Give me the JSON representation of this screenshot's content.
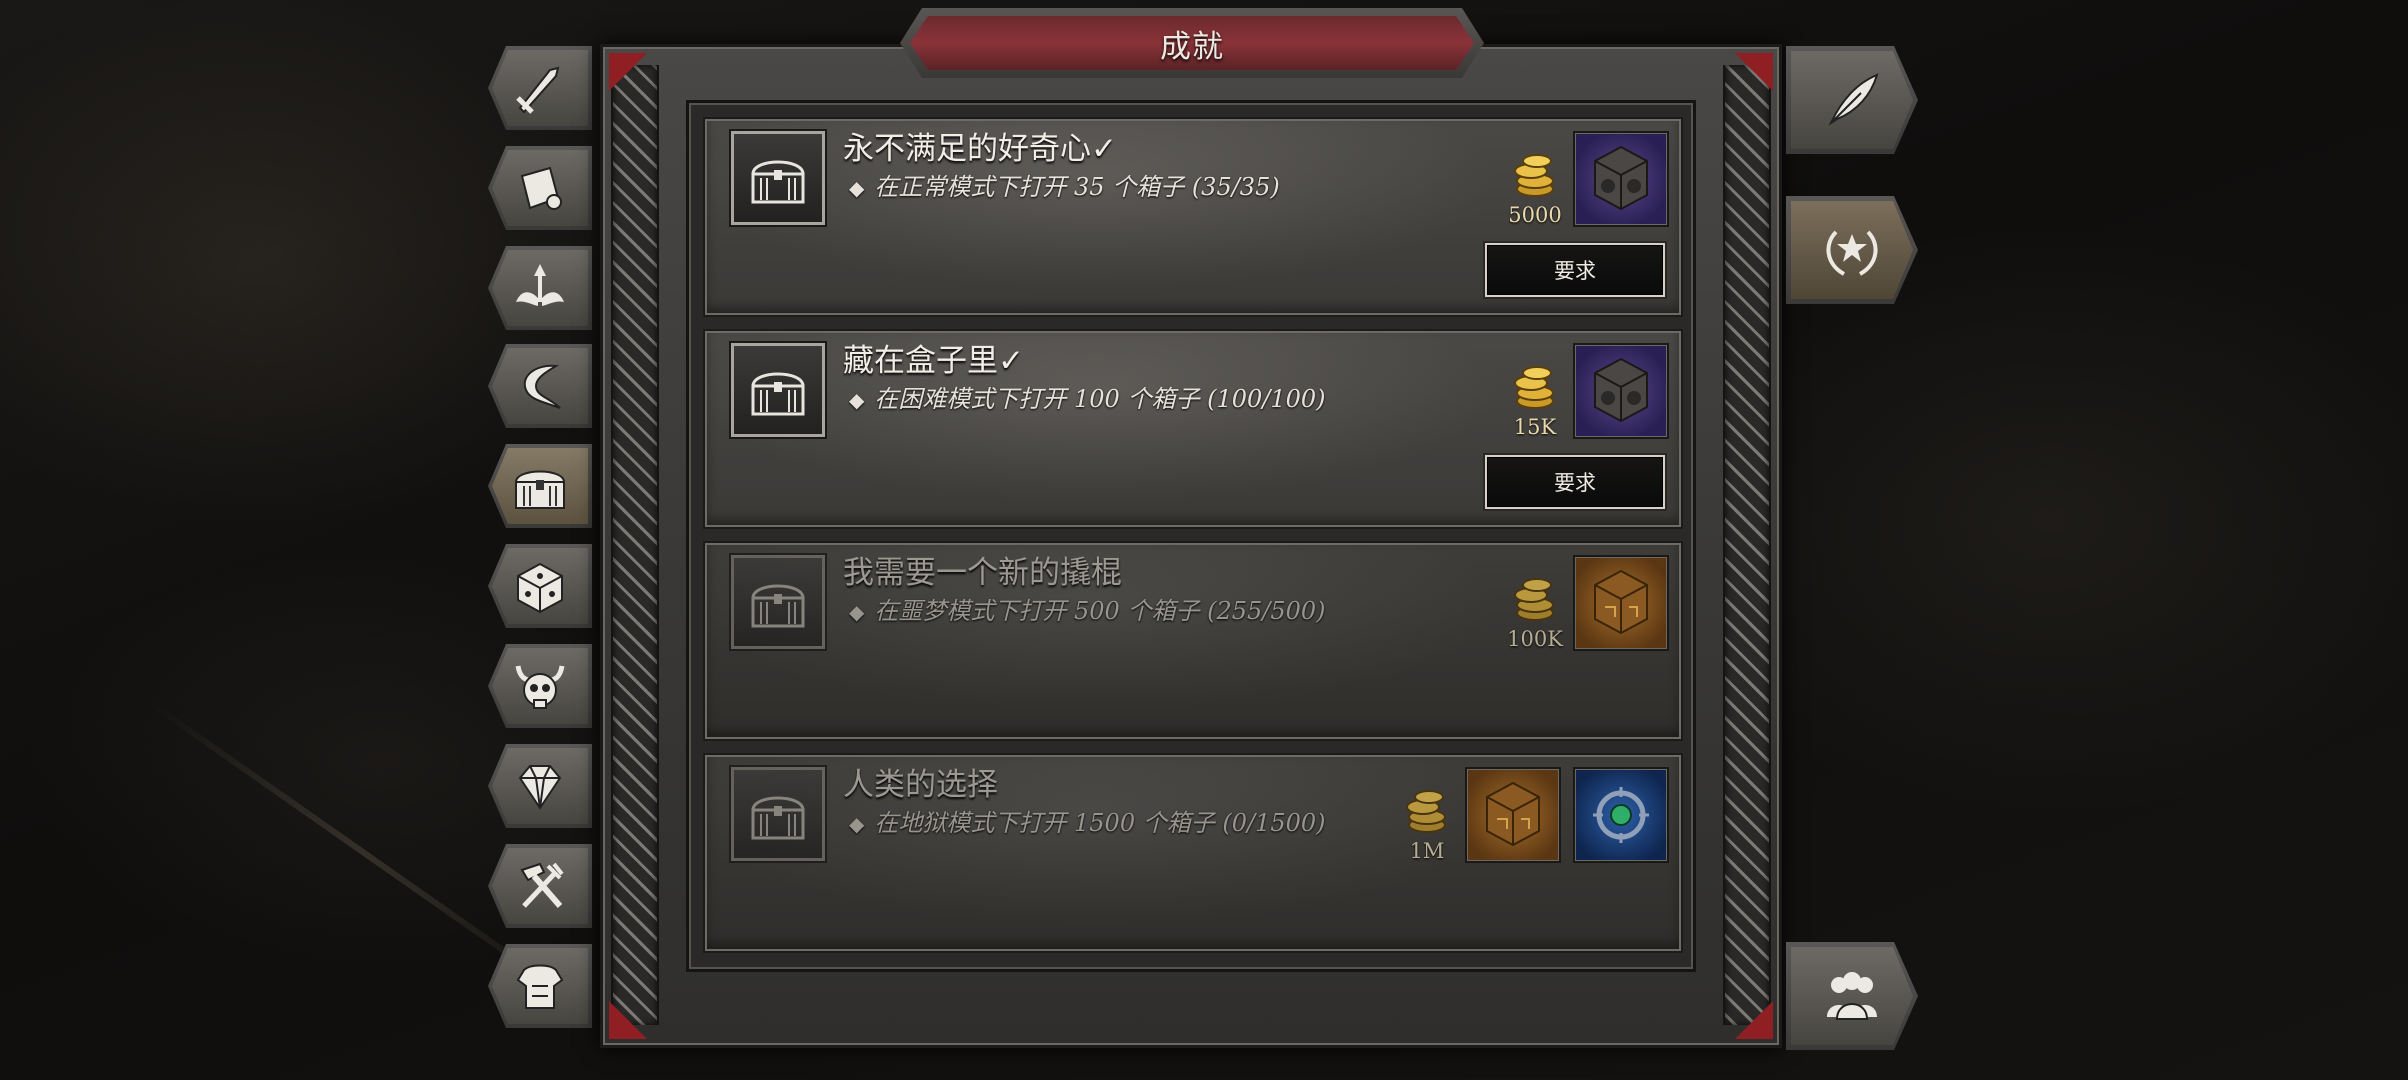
{
  "window": {
    "title": "成就"
  },
  "achievements": [
    {
      "title": "永不满足的好奇心✓",
      "desc": "在正常模式下打开 35 个箱子 (35/35)",
      "gold": "5000",
      "completed": true,
      "button": "要求",
      "items": [
        "purple-cube-icon"
      ]
    },
    {
      "title": "藏在盒子里✓",
      "desc": "在困难模式下打开 100 个箱子 (100/100)",
      "gold": "15K",
      "completed": true,
      "button": "要求",
      "items": [
        "purple-cube-icon"
      ]
    },
    {
      "title": "我需要一个新的撬棍",
      "desc": "在噩梦模式下打开 500 个箱子 (255/500)",
      "gold": "100K",
      "completed": false,
      "items": [
        "orange-cube-icon"
      ]
    },
    {
      "title": "人类的选择",
      "desc": "在地狱模式下打开 1500 个箱子 (0/1500)",
      "gold": "1M",
      "completed": false,
      "items": [
        "orange-cube-icon",
        "blue-amulet-icon"
      ]
    }
  ],
  "left_tabs": [
    "sword-icon",
    "scroll-icon",
    "winged-arrow-icon",
    "horn-icon",
    "chest-icon",
    "dice-icon",
    "demon-skull-icon",
    "gem-icon",
    "hammer-icon",
    "armor-icon"
  ],
  "right_tabs": [
    "quill-icon",
    "laurel-star-icon",
    "party-icon"
  ],
  "colors": {
    "accent_red": "#8a3338",
    "gold_text": "#e9d9a8",
    "frame": "#3a3937"
  }
}
